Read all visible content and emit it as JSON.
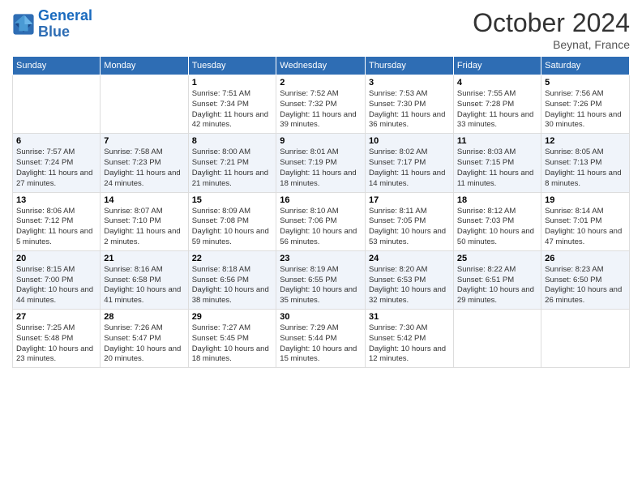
{
  "header": {
    "logo_text_general": "General",
    "logo_text_blue": "Blue",
    "month_title": "October 2024",
    "location": "Beynat, France"
  },
  "days_of_week": [
    "Sunday",
    "Monday",
    "Tuesday",
    "Wednesday",
    "Thursday",
    "Friday",
    "Saturday"
  ],
  "weeks": [
    [
      {
        "day": "",
        "sunrise": "",
        "sunset": "",
        "daylight": ""
      },
      {
        "day": "",
        "sunrise": "",
        "sunset": "",
        "daylight": ""
      },
      {
        "day": "1",
        "sunrise": "Sunrise: 7:51 AM",
        "sunset": "Sunset: 7:34 PM",
        "daylight": "Daylight: 11 hours and 42 minutes."
      },
      {
        "day": "2",
        "sunrise": "Sunrise: 7:52 AM",
        "sunset": "Sunset: 7:32 PM",
        "daylight": "Daylight: 11 hours and 39 minutes."
      },
      {
        "day": "3",
        "sunrise": "Sunrise: 7:53 AM",
        "sunset": "Sunset: 7:30 PM",
        "daylight": "Daylight: 11 hours and 36 minutes."
      },
      {
        "day": "4",
        "sunrise": "Sunrise: 7:55 AM",
        "sunset": "Sunset: 7:28 PM",
        "daylight": "Daylight: 11 hours and 33 minutes."
      },
      {
        "day": "5",
        "sunrise": "Sunrise: 7:56 AM",
        "sunset": "Sunset: 7:26 PM",
        "daylight": "Daylight: 11 hours and 30 minutes."
      }
    ],
    [
      {
        "day": "6",
        "sunrise": "Sunrise: 7:57 AM",
        "sunset": "Sunset: 7:24 PM",
        "daylight": "Daylight: 11 hours and 27 minutes."
      },
      {
        "day": "7",
        "sunrise": "Sunrise: 7:58 AM",
        "sunset": "Sunset: 7:23 PM",
        "daylight": "Daylight: 11 hours and 24 minutes."
      },
      {
        "day": "8",
        "sunrise": "Sunrise: 8:00 AM",
        "sunset": "Sunset: 7:21 PM",
        "daylight": "Daylight: 11 hours and 21 minutes."
      },
      {
        "day": "9",
        "sunrise": "Sunrise: 8:01 AM",
        "sunset": "Sunset: 7:19 PM",
        "daylight": "Daylight: 11 hours and 18 minutes."
      },
      {
        "day": "10",
        "sunrise": "Sunrise: 8:02 AM",
        "sunset": "Sunset: 7:17 PM",
        "daylight": "Daylight: 11 hours and 14 minutes."
      },
      {
        "day": "11",
        "sunrise": "Sunrise: 8:03 AM",
        "sunset": "Sunset: 7:15 PM",
        "daylight": "Daylight: 11 hours and 11 minutes."
      },
      {
        "day": "12",
        "sunrise": "Sunrise: 8:05 AM",
        "sunset": "Sunset: 7:13 PM",
        "daylight": "Daylight: 11 hours and 8 minutes."
      }
    ],
    [
      {
        "day": "13",
        "sunrise": "Sunrise: 8:06 AM",
        "sunset": "Sunset: 7:12 PM",
        "daylight": "Daylight: 11 hours and 5 minutes."
      },
      {
        "day": "14",
        "sunrise": "Sunrise: 8:07 AM",
        "sunset": "Sunset: 7:10 PM",
        "daylight": "Daylight: 11 hours and 2 minutes."
      },
      {
        "day": "15",
        "sunrise": "Sunrise: 8:09 AM",
        "sunset": "Sunset: 7:08 PM",
        "daylight": "Daylight: 10 hours and 59 minutes."
      },
      {
        "day": "16",
        "sunrise": "Sunrise: 8:10 AM",
        "sunset": "Sunset: 7:06 PM",
        "daylight": "Daylight: 10 hours and 56 minutes."
      },
      {
        "day": "17",
        "sunrise": "Sunrise: 8:11 AM",
        "sunset": "Sunset: 7:05 PM",
        "daylight": "Daylight: 10 hours and 53 minutes."
      },
      {
        "day": "18",
        "sunrise": "Sunrise: 8:12 AM",
        "sunset": "Sunset: 7:03 PM",
        "daylight": "Daylight: 10 hours and 50 minutes."
      },
      {
        "day": "19",
        "sunrise": "Sunrise: 8:14 AM",
        "sunset": "Sunset: 7:01 PM",
        "daylight": "Daylight: 10 hours and 47 minutes."
      }
    ],
    [
      {
        "day": "20",
        "sunrise": "Sunrise: 8:15 AM",
        "sunset": "Sunset: 7:00 PM",
        "daylight": "Daylight: 10 hours and 44 minutes."
      },
      {
        "day": "21",
        "sunrise": "Sunrise: 8:16 AM",
        "sunset": "Sunset: 6:58 PM",
        "daylight": "Daylight: 10 hours and 41 minutes."
      },
      {
        "day": "22",
        "sunrise": "Sunrise: 8:18 AM",
        "sunset": "Sunset: 6:56 PM",
        "daylight": "Daylight: 10 hours and 38 minutes."
      },
      {
        "day": "23",
        "sunrise": "Sunrise: 8:19 AM",
        "sunset": "Sunset: 6:55 PM",
        "daylight": "Daylight: 10 hours and 35 minutes."
      },
      {
        "day": "24",
        "sunrise": "Sunrise: 8:20 AM",
        "sunset": "Sunset: 6:53 PM",
        "daylight": "Daylight: 10 hours and 32 minutes."
      },
      {
        "day": "25",
        "sunrise": "Sunrise: 8:22 AM",
        "sunset": "Sunset: 6:51 PM",
        "daylight": "Daylight: 10 hours and 29 minutes."
      },
      {
        "day": "26",
        "sunrise": "Sunrise: 8:23 AM",
        "sunset": "Sunset: 6:50 PM",
        "daylight": "Daylight: 10 hours and 26 minutes."
      }
    ],
    [
      {
        "day": "27",
        "sunrise": "Sunrise: 7:25 AM",
        "sunset": "Sunset: 5:48 PM",
        "daylight": "Daylight: 10 hours and 23 minutes."
      },
      {
        "day": "28",
        "sunrise": "Sunrise: 7:26 AM",
        "sunset": "Sunset: 5:47 PM",
        "daylight": "Daylight: 10 hours and 20 minutes."
      },
      {
        "day": "29",
        "sunrise": "Sunrise: 7:27 AM",
        "sunset": "Sunset: 5:45 PM",
        "daylight": "Daylight: 10 hours and 18 minutes."
      },
      {
        "day": "30",
        "sunrise": "Sunrise: 7:29 AM",
        "sunset": "Sunset: 5:44 PM",
        "daylight": "Daylight: 10 hours and 15 minutes."
      },
      {
        "day": "31",
        "sunrise": "Sunrise: 7:30 AM",
        "sunset": "Sunset: 5:42 PM",
        "daylight": "Daylight: 10 hours and 12 minutes."
      },
      {
        "day": "",
        "sunrise": "",
        "sunset": "",
        "daylight": ""
      },
      {
        "day": "",
        "sunrise": "",
        "sunset": "",
        "daylight": ""
      }
    ]
  ]
}
